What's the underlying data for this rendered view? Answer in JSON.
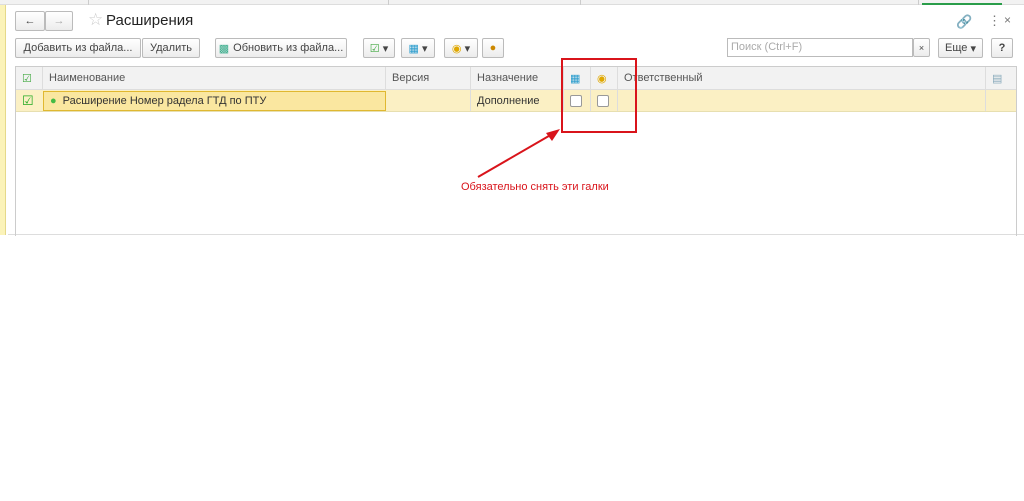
{
  "title": "Расширения",
  "toolbar": {
    "add_from_file": "Добавить из файла...",
    "delete": "Удалить",
    "update_from_file": "Обновить из файла...",
    "search_placeholder": "Поиск (Ctrl+F)",
    "more": "Еще",
    "help": "?"
  },
  "table": {
    "columns": [
      "Наименование",
      "Версия",
      "Назначение",
      "Ответственный"
    ],
    "rows": [
      {
        "checked": true,
        "name": "Расширение Номер радела ГТД по ПТУ",
        "version": "",
        "purpose": "Дополнение",
        "safe_mode": false,
        "protection": false,
        "responsible": ""
      }
    ]
  },
  "annotation": {
    "text": "Обязательно снять эти галки",
    "color": "#d9141b"
  }
}
